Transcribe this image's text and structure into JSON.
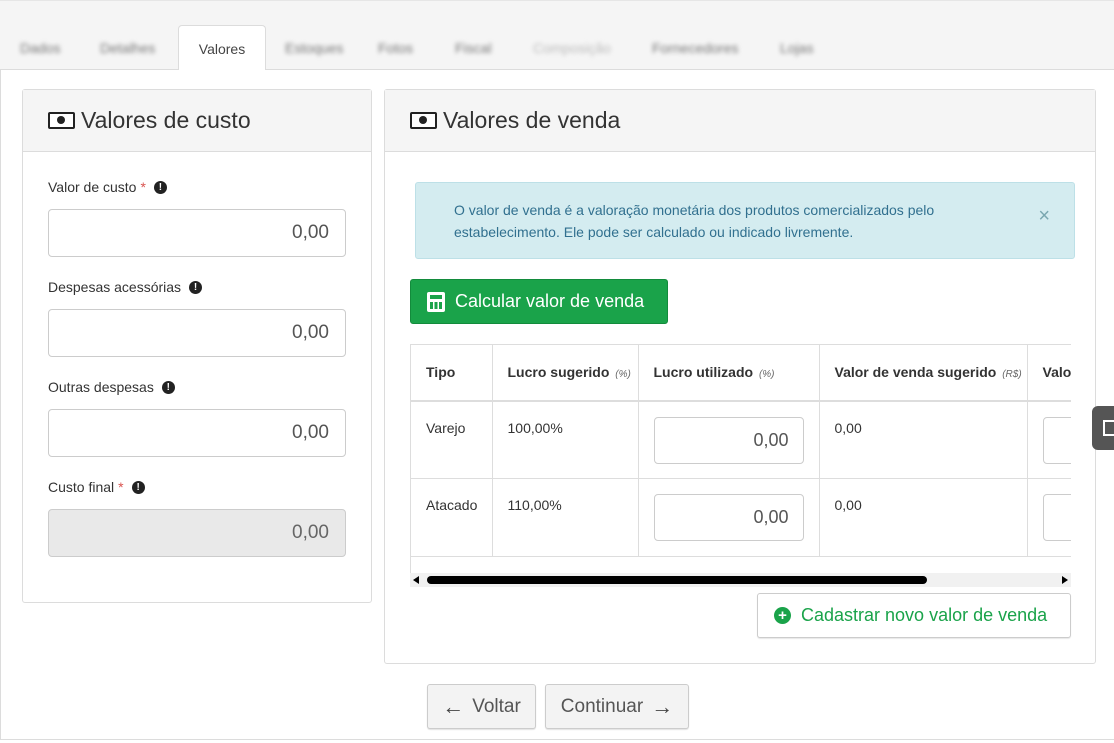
{
  "tabs": [
    {
      "label": "Dados",
      "active": false
    },
    {
      "label": "Detalhes",
      "active": false
    },
    {
      "label": "Valores",
      "active": true
    },
    {
      "label": "Estoques",
      "active": false
    },
    {
      "label": "Fotos",
      "active": false
    },
    {
      "label": "Fiscal",
      "active": false
    },
    {
      "label": "Composição",
      "active": false
    },
    {
      "label": "Fornecedores",
      "active": false
    },
    {
      "label": "Lojas",
      "active": false
    }
  ],
  "custo": {
    "title": "Valores de custo",
    "valor_custo_label": "Valor de custo",
    "valor_custo_value": "0,00",
    "despesas_label": "Despesas acessórias",
    "despesas_value": "0,00",
    "outras_label": "Outras despesas",
    "outras_value": "0,00",
    "custo_final_label": "Custo final",
    "custo_final_value": "0,00",
    "required_mark": "*",
    "info_mark": "!"
  },
  "venda": {
    "title": "Valores de venda",
    "alert_text": "O valor de venda é a valoração monetária dos produtos comercializados pelo estabelecimento. Ele pode ser calculado ou indicado livremente.",
    "alert_close": "×",
    "calc_button": "Calcular valor de venda",
    "table": {
      "headers": [
        {
          "label": "Tipo",
          "unit": ""
        },
        {
          "label": "Lucro sugerido",
          "unit": "(%)"
        },
        {
          "label": "Lucro utilizado",
          "unit": "(%)"
        },
        {
          "label": "Valor de venda sugerido",
          "unit": "(R$)"
        },
        {
          "label": "Valo",
          "unit": ""
        }
      ],
      "rows": [
        {
          "tipo": "Varejo",
          "lucro_sugerido": "100,00%",
          "lucro_utilizado": "0,00",
          "valor_sugerido": "0,00"
        },
        {
          "tipo": "Atacado",
          "lucro_sugerido": "110,00%",
          "lucro_utilizado": "0,00",
          "valor_sugerido": "0,00"
        }
      ]
    },
    "add_button": "Cadastrar novo valor de venda"
  },
  "nav": {
    "back": "Voltar",
    "continue": "Continuar"
  },
  "colors": {
    "green": "#1aa34a",
    "alert_bg": "#d4ecf0",
    "alert_text": "#31708f",
    "required": "#d9534f"
  }
}
